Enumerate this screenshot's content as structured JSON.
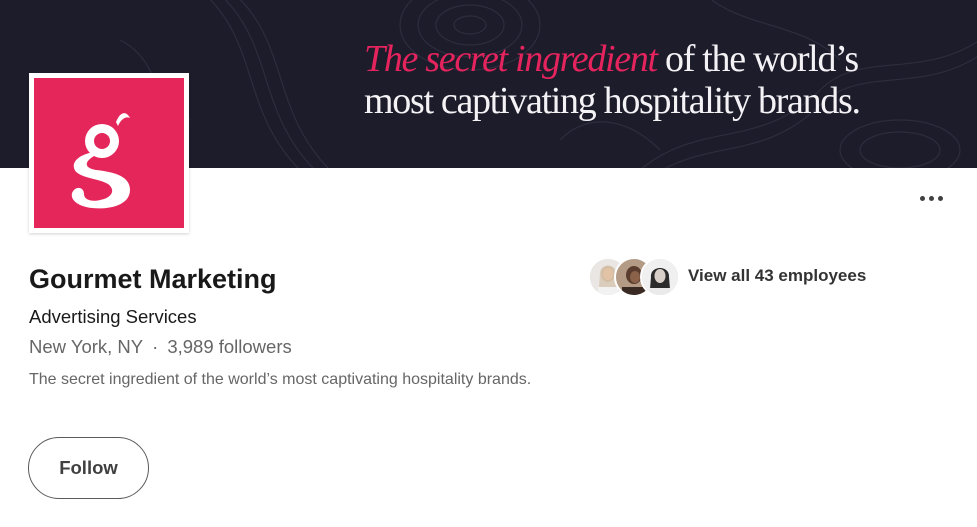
{
  "banner": {
    "tagline_accent": "The secret ingredient",
    "tagline_rest_line1": " of the world’s",
    "tagline_line2": "most captivating hospitality brands.",
    "colors": {
      "background": "#1d1c2b",
      "accent": "#e5245e",
      "text": "#f4f2f5"
    }
  },
  "logo": {
    "letter": "g",
    "background": "#e5265b"
  },
  "company": {
    "name": "Gourmet Marketing",
    "industry": "Advertising Services",
    "location": "New York, NY",
    "separator": "·",
    "followers": "3,989 followers",
    "description": "The secret ingredient of the world’s most captivating hospitality brands."
  },
  "actions": {
    "follow_label": "Follow",
    "more_icon": "ellipsis-icon"
  },
  "employees": {
    "link_text": "View all 43 employees",
    "avatar_count": 3
  }
}
